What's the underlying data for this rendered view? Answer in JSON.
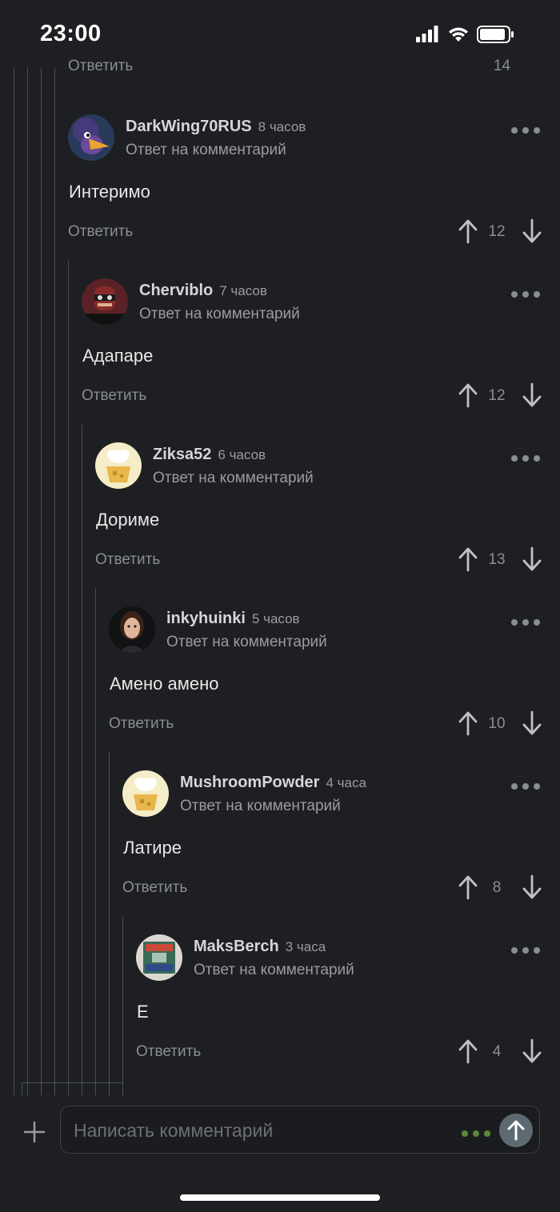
{
  "status_bar": {
    "time": "23:00"
  },
  "cutoff_comment": {
    "reply_label": "Ответить",
    "score": "14"
  },
  "comments": [
    {
      "author": "DarkWing70RUS",
      "time_ago": "8 часов",
      "reply_to": "Ответ на комментарий",
      "text": "Интеримо",
      "reply_label": "Ответить",
      "score": "12"
    },
    {
      "author": "Cherviblo",
      "time_ago": "7 часов",
      "reply_to": "Ответ на комментарий",
      "text": "Адапаре",
      "reply_label": "Ответить",
      "score": "12"
    },
    {
      "author": "Ziksa52",
      "time_ago": "6 часов",
      "reply_to": "Ответ на комментарий",
      "text": "Дориме",
      "reply_label": "Ответить",
      "score": "13"
    },
    {
      "author": "inkyhuinki",
      "time_ago": "5 часов",
      "reply_to": "Ответ на комментарий",
      "text": "Амено амено",
      "reply_label": "Ответить",
      "score": "10"
    },
    {
      "author": "MushroomPowder",
      "time_ago": "4 часа",
      "reply_to": "Ответ на комментарий",
      "text": "Латире",
      "reply_label": "Ответить",
      "score": "8"
    },
    {
      "author": "MaksBerch",
      "time_ago": "3 часа",
      "reply_to": "Ответ на комментарий",
      "text": "Е",
      "reply_label": "Ответить",
      "score": "4"
    }
  ],
  "composer": {
    "placeholder": "Написать комментарий"
  },
  "icons": {
    "more": "more-dots-icon",
    "upvote": "arrow-up-icon",
    "downvote": "arrow-down-icon",
    "add": "plus-icon",
    "send": "send-arrow-icon"
  },
  "colors": {
    "background": "#1d1f22",
    "typing_dots": "#5c8a3a",
    "send_button": "#5e6a72"
  }
}
